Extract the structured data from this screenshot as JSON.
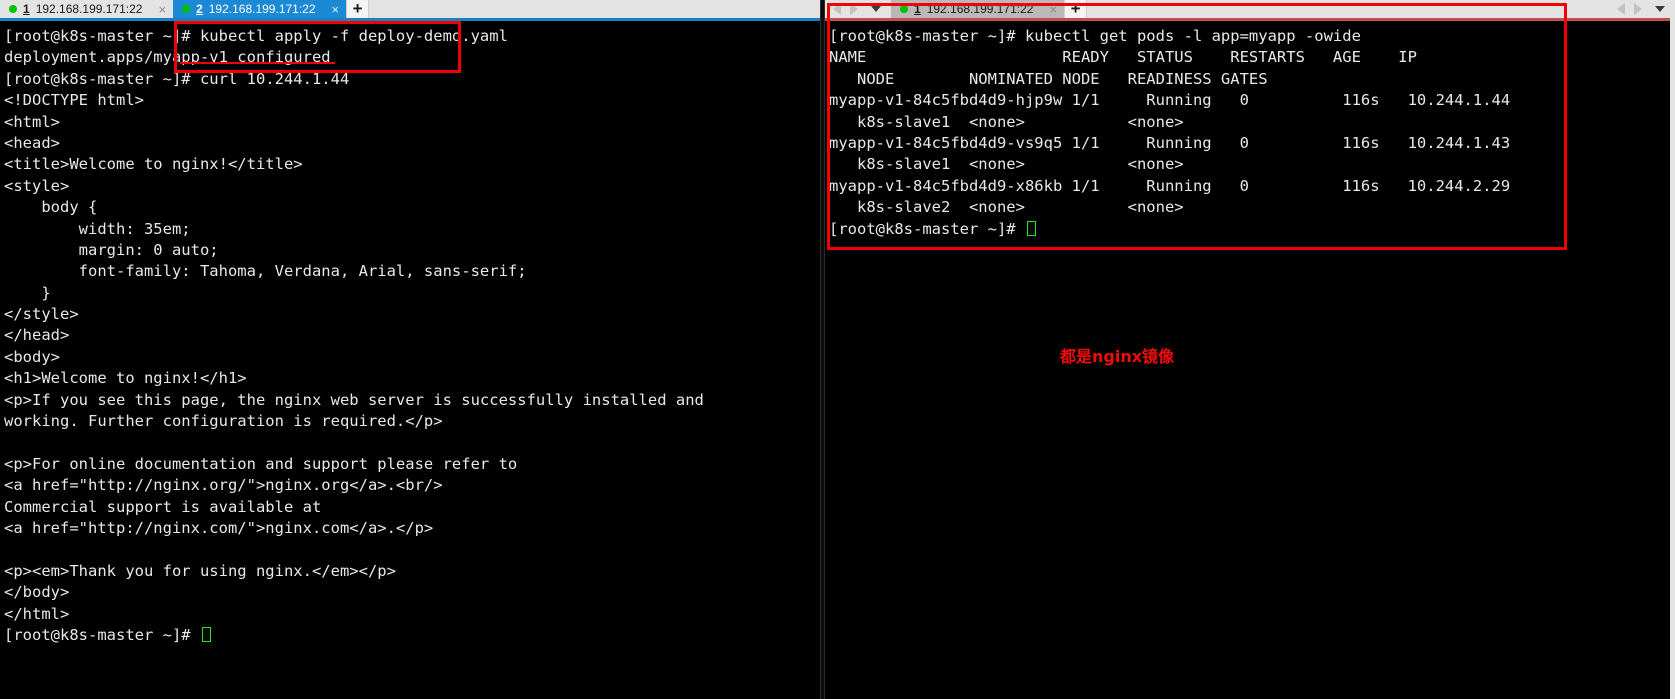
{
  "window": {
    "left_pane": {
      "nav": {
        "back_icon": "arrow-left-icon",
        "forward_icon": "arrow-right-icon",
        "menu_icon": "chevron-down-icon"
      },
      "tabs": [
        {
          "index": "1",
          "label": "192.168.199.171:22",
          "active": false,
          "status": "connected",
          "close_label": "×"
        },
        {
          "index": "2",
          "label": "192.168.199.171:22",
          "active": true,
          "status": "connected",
          "close_label": "×"
        }
      ],
      "new_tab_label": "+",
      "accent_color": "#1b7fc4"
    },
    "right_pane": {
      "nav": {
        "back_icon": "arrow-left-icon",
        "forward_icon": "arrow-right-icon",
        "menu_icon": "chevron-down-icon"
      },
      "tabs": [
        {
          "index": "1",
          "label": "192.168.199.171:22",
          "active": true,
          "status": "connected",
          "close_label": "×"
        }
      ],
      "new_tab_label": "+",
      "accent_color": "#c0504d"
    }
  },
  "left_terminal": {
    "prompt": "[root@k8s-master ~]# ",
    "lines": [
      "[root@k8s-master ~]# kubectl apply -f deploy-demo.yaml",
      "deployment.apps/myapp-v1 configured",
      "[root@k8s-master ~]# curl 10.244.1.44",
      "<!DOCTYPE html>",
      "<html>",
      "<head>",
      "<title>Welcome to nginx!</title>",
      "<style>",
      "    body {",
      "        width: 35em;",
      "        margin: 0 auto;",
      "        font-family: Tahoma, Verdana, Arial, sans-serif;",
      "    }",
      "</style>",
      "</head>",
      "<body>",
      "<h1>Welcome to nginx!</h1>",
      "<p>If you see this page, the nginx web server is successfully installed and",
      "working. Further configuration is required.</p>",
      "",
      "<p>For online documentation and support please refer to",
      "<a href=\"http://nginx.org/\">nginx.org</a>.<br/>",
      "Commercial support is available at",
      "<a href=\"http://nginx.com/\">nginx.com</a>.</p>",
      "",
      "<p><em>Thank you for using nginx.</em></p>",
      "</body>",
      "</html>",
      "[root@k8s-master ~]# "
    ]
  },
  "right_terminal": {
    "command_line": "[root@k8s-master ~]# kubectl get pods -l app=myapp -owide",
    "header_line_1": "NAME                     READY   STATUS    RESTARTS   AGE    IP",
    "header_line_2": "   NODE        NOMINATED NODE   READINESS GATES",
    "columns": [
      "NAME",
      "READY",
      "STATUS",
      "RESTARTS",
      "AGE",
      "IP",
      "NODE",
      "NOMINATED NODE",
      "READINESS GATES"
    ],
    "pods": [
      {
        "name": "myapp-v1-84c5fbd4d9-hjp9w",
        "ready": "1/1",
        "status": "Running",
        "restarts": "0",
        "age": "116s",
        "ip": "10.244.1.44",
        "node": "k8s-slave1",
        "nominated_node": "<none>",
        "readiness_gates": "<none>"
      },
      {
        "name": "myapp-v1-84c5fbd4d9-vs9q5",
        "ready": "1/1",
        "status": "Running",
        "restarts": "0",
        "age": "116s",
        "ip": "10.244.1.43",
        "node": "k8s-slave1",
        "nominated_node": "<none>",
        "readiness_gates": "<none>"
      },
      {
        "name": "myapp-v1-84c5fbd4d9-x86kb",
        "ready": "1/1",
        "status": "Running",
        "restarts": "0",
        "age": "116s",
        "ip": "10.244.2.29",
        "node": "k8s-slave2",
        "nominated_node": "<none>",
        "readiness_gates": "<none>"
      }
    ],
    "final_prompt": "[root@k8s-master ~]# "
  },
  "annotations": {
    "highlight_color": "#f30000",
    "note_text": "都是nginx镜像",
    "note_color": "#f30a0a"
  }
}
